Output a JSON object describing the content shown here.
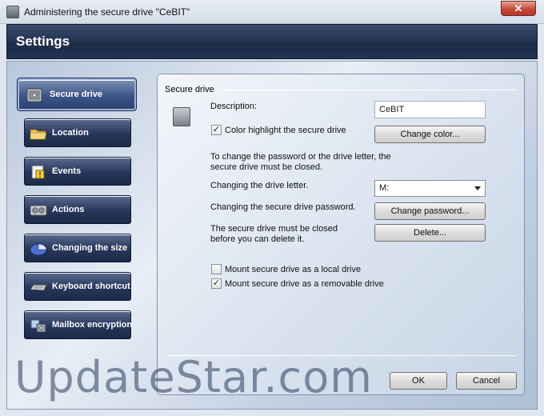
{
  "window": {
    "title": "Administering the secure drive \"CeBIT\"",
    "close_glyph": "✕"
  },
  "header": {
    "title": "Settings"
  },
  "nav": [
    {
      "label": "Secure drive",
      "icon": "safe-icon",
      "active": true
    },
    {
      "label": "Location",
      "icon": "folder-icon"
    },
    {
      "label": "Events",
      "icon": "events-icon"
    },
    {
      "label": "Actions",
      "icon": "gears-icon"
    },
    {
      "label": "Changing the size",
      "icon": "pie-icon"
    },
    {
      "label": "Keyboard shortcut",
      "icon": "keyboard-icon"
    },
    {
      "label": "Mailbox encryption",
      "icon": "mailbox-icon"
    }
  ],
  "panel": {
    "group_title": "Secure drive",
    "description_label": "Description:",
    "description_value": "CeBIT",
    "color_highlight": {
      "label": "Color highlight the secure drive",
      "checked": true
    },
    "change_color_button": "Change color...",
    "info_text": "To change the password or the drive letter, the secure drive must be closed.",
    "drive_letter_label": "Changing the drive letter.",
    "drive_letter_value": "M:",
    "password_label": "Changing the secure drive password.",
    "change_password_button": "Change password...",
    "delete_label": "The secure drive must be closed before you can delete it.",
    "delete_button": "Delete...",
    "mount_local": {
      "label": "Mount secure drive as a local drive",
      "checked": false
    },
    "mount_removable": {
      "label": "Mount secure drive as a removable drive",
      "checked": true
    },
    "check_glyph": "✓"
  },
  "footer": {
    "ok_button": "OK",
    "cancel_button": "Cancel"
  },
  "watermark": "UpdateStar.com"
}
